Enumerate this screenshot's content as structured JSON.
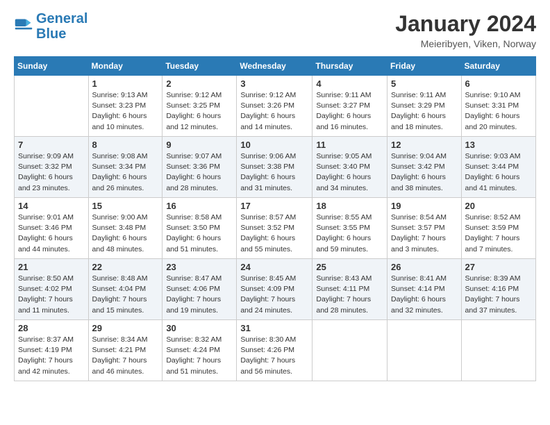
{
  "logo": {
    "line1": "General",
    "line2": "Blue"
  },
  "title": "January 2024",
  "location": "Meieribyen, Viken, Norway",
  "days_of_week": [
    "Sunday",
    "Monday",
    "Tuesday",
    "Wednesday",
    "Thursday",
    "Friday",
    "Saturday"
  ],
  "weeks": [
    [
      {
        "day": "",
        "info": ""
      },
      {
        "day": "1",
        "info": "Sunrise: 9:13 AM\nSunset: 3:23 PM\nDaylight: 6 hours\nand 10 minutes."
      },
      {
        "day": "2",
        "info": "Sunrise: 9:12 AM\nSunset: 3:25 PM\nDaylight: 6 hours\nand 12 minutes."
      },
      {
        "day": "3",
        "info": "Sunrise: 9:12 AM\nSunset: 3:26 PM\nDaylight: 6 hours\nand 14 minutes."
      },
      {
        "day": "4",
        "info": "Sunrise: 9:11 AM\nSunset: 3:27 PM\nDaylight: 6 hours\nand 16 minutes."
      },
      {
        "day": "5",
        "info": "Sunrise: 9:11 AM\nSunset: 3:29 PM\nDaylight: 6 hours\nand 18 minutes."
      },
      {
        "day": "6",
        "info": "Sunrise: 9:10 AM\nSunset: 3:31 PM\nDaylight: 6 hours\nand 20 minutes."
      }
    ],
    [
      {
        "day": "7",
        "info": "Sunrise: 9:09 AM\nSunset: 3:32 PM\nDaylight: 6 hours\nand 23 minutes."
      },
      {
        "day": "8",
        "info": "Sunrise: 9:08 AM\nSunset: 3:34 PM\nDaylight: 6 hours\nand 26 minutes."
      },
      {
        "day": "9",
        "info": "Sunrise: 9:07 AM\nSunset: 3:36 PM\nDaylight: 6 hours\nand 28 minutes."
      },
      {
        "day": "10",
        "info": "Sunrise: 9:06 AM\nSunset: 3:38 PM\nDaylight: 6 hours\nand 31 minutes."
      },
      {
        "day": "11",
        "info": "Sunrise: 9:05 AM\nSunset: 3:40 PM\nDaylight: 6 hours\nand 34 minutes."
      },
      {
        "day": "12",
        "info": "Sunrise: 9:04 AM\nSunset: 3:42 PM\nDaylight: 6 hours\nand 38 minutes."
      },
      {
        "day": "13",
        "info": "Sunrise: 9:03 AM\nSunset: 3:44 PM\nDaylight: 6 hours\nand 41 minutes."
      }
    ],
    [
      {
        "day": "14",
        "info": "Sunrise: 9:01 AM\nSunset: 3:46 PM\nDaylight: 6 hours\nand 44 minutes."
      },
      {
        "day": "15",
        "info": "Sunrise: 9:00 AM\nSunset: 3:48 PM\nDaylight: 6 hours\nand 48 minutes."
      },
      {
        "day": "16",
        "info": "Sunrise: 8:58 AM\nSunset: 3:50 PM\nDaylight: 6 hours\nand 51 minutes."
      },
      {
        "day": "17",
        "info": "Sunrise: 8:57 AM\nSunset: 3:52 PM\nDaylight: 6 hours\nand 55 minutes."
      },
      {
        "day": "18",
        "info": "Sunrise: 8:55 AM\nSunset: 3:55 PM\nDaylight: 6 hours\nand 59 minutes."
      },
      {
        "day": "19",
        "info": "Sunrise: 8:54 AM\nSunset: 3:57 PM\nDaylight: 7 hours\nand 3 minutes."
      },
      {
        "day": "20",
        "info": "Sunrise: 8:52 AM\nSunset: 3:59 PM\nDaylight: 7 hours\nand 7 minutes."
      }
    ],
    [
      {
        "day": "21",
        "info": "Sunrise: 8:50 AM\nSunset: 4:02 PM\nDaylight: 7 hours\nand 11 minutes."
      },
      {
        "day": "22",
        "info": "Sunrise: 8:48 AM\nSunset: 4:04 PM\nDaylight: 7 hours\nand 15 minutes."
      },
      {
        "day": "23",
        "info": "Sunrise: 8:47 AM\nSunset: 4:06 PM\nDaylight: 7 hours\nand 19 minutes."
      },
      {
        "day": "24",
        "info": "Sunrise: 8:45 AM\nSunset: 4:09 PM\nDaylight: 7 hours\nand 24 minutes."
      },
      {
        "day": "25",
        "info": "Sunrise: 8:43 AM\nSunset: 4:11 PM\nDaylight: 7 hours\nand 28 minutes."
      },
      {
        "day": "26",
        "info": "Sunrise: 8:41 AM\nSunset: 4:14 PM\nDaylight: 6 hours\nand 32 minutes."
      },
      {
        "day": "27",
        "info": "Sunrise: 8:39 AM\nSunset: 4:16 PM\nDaylight: 7 hours\nand 37 minutes."
      }
    ],
    [
      {
        "day": "28",
        "info": "Sunrise: 8:37 AM\nSunset: 4:19 PM\nDaylight: 7 hours\nand 42 minutes."
      },
      {
        "day": "29",
        "info": "Sunrise: 8:34 AM\nSunset: 4:21 PM\nDaylight: 7 hours\nand 46 minutes."
      },
      {
        "day": "30",
        "info": "Sunrise: 8:32 AM\nSunset: 4:24 PM\nDaylight: 7 hours\nand 51 minutes."
      },
      {
        "day": "31",
        "info": "Sunrise: 8:30 AM\nSunset: 4:26 PM\nDaylight: 7 hours\nand 56 minutes."
      },
      {
        "day": "",
        "info": ""
      },
      {
        "day": "",
        "info": ""
      },
      {
        "day": "",
        "info": ""
      }
    ]
  ]
}
